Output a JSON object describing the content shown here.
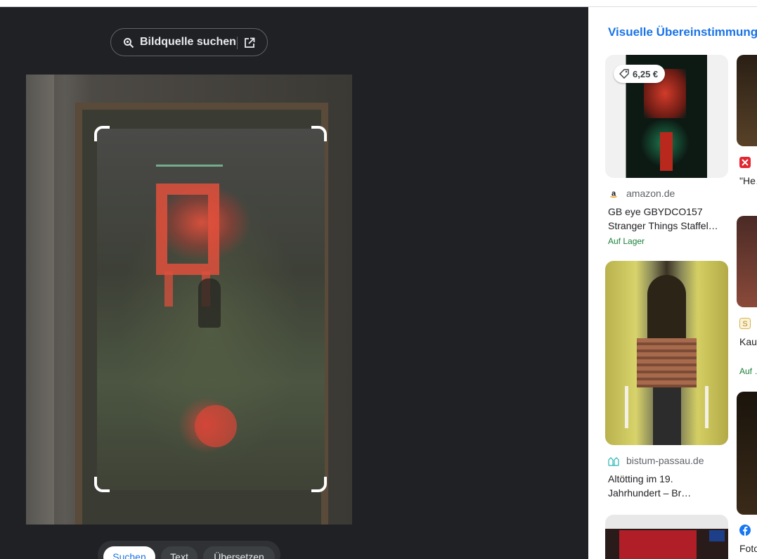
{
  "source_search": {
    "label": "Bildquelle suchen",
    "icons": [
      "lens-search-icon",
      "open-in-new-icon"
    ]
  },
  "modes": [
    {
      "label": "Suchen",
      "active": true
    },
    {
      "label": "Text",
      "active": false
    },
    {
      "label": "Übersetzen",
      "active": false
    }
  ],
  "results": {
    "heading": "Visuelle Übereinstimmungen",
    "col1": [
      {
        "price": "6,25 €",
        "site": "amazon.de",
        "title": "GB eye GBYDCO157 Stranger Things Staffel…",
        "stock": "Auf Lager"
      },
      {
        "site": "bistum-passau.de",
        "title": "Altötting im 19. Jahrhundert – Br…"
      }
    ],
    "col2": [
      {
        "title": "\"He… Net…"
      },
      {
        "title": "Kau… Ölg…",
        "stock": "Auf …"
      },
      {
        "title": "Foto…"
      }
    ]
  },
  "colors": {
    "accent": "#1a73e8",
    "panel_dark": "#202124",
    "stock_green": "#188038"
  }
}
